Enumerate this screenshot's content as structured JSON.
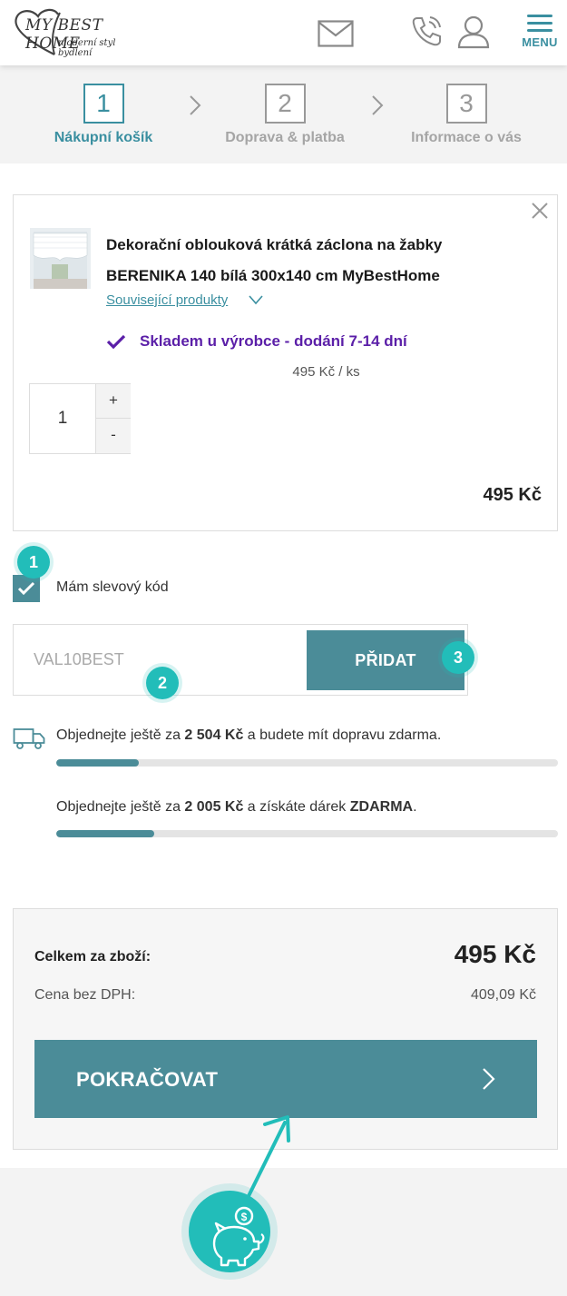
{
  "header": {
    "logo_main": "MY BEST HOME",
    "logo_tagline": "moderní styl bydlení",
    "menu_label": "MENU"
  },
  "steps": [
    {
      "number": "1",
      "label": "Nákupní košík",
      "active": true
    },
    {
      "number": "2",
      "label": "Doprava & platba",
      "active": false
    },
    {
      "number": "3",
      "label": "Informace o vás",
      "active": false
    }
  ],
  "cart_item": {
    "title": "Dekorační oblouková krátká záclona na žabky BERENIKA 140 bílá 300x140 cm MyBestHome",
    "related_link": "Související produkty",
    "stock_status": "Skladem u výrobce - dodání 7-14 dní",
    "unit_price": "495 Kč / ks",
    "quantity": "1",
    "plus_label": "+",
    "minus_label": "-",
    "line_total": "495 Kč"
  },
  "discount": {
    "checkbox_label": "Mám slevový kód",
    "checked": true,
    "input_value": "VAL10BEST",
    "add_button": "PŘIDAT"
  },
  "annotations": {
    "badge1": "1",
    "badge2": "2",
    "badge3": "3"
  },
  "free_shipping": {
    "prefix": "Objednejte ještě za ",
    "amount": "2 504 Kč",
    "suffix": " a budete mít dopravu zdarma.",
    "progress": 0.165
  },
  "free_gift": {
    "prefix": "Objednejte ještě za ",
    "amount": "2 005 Kč",
    "middle": " a získáte dárek ",
    "highlight": "ZDARMA",
    "end": ".",
    "progress": 0.195
  },
  "summary": {
    "total_label": "Celkem za zboží:",
    "total_value": "495 Kč",
    "no_vat_label": "Cena bez DPH:",
    "no_vat_value": "409,09 Kč",
    "continue_button": "POKRAČOVAT"
  },
  "colors": {
    "accent": "#4b8c98",
    "stock": "#5b1fa8",
    "annotation": "#22bdb9"
  }
}
